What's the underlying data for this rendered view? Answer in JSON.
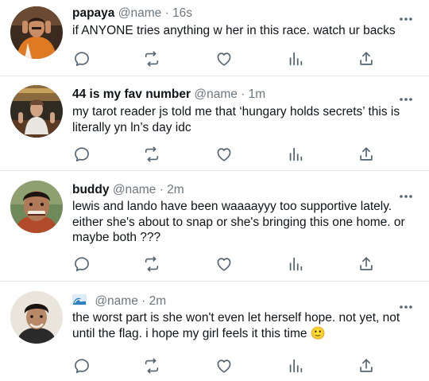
{
  "tweets": [
    {
      "name": "papaya",
      "handle": "@name",
      "time": "16s",
      "text": "if ANYONE tries anything w her in this race. watch ur backs"
    },
    {
      "name": "44 is my fav number",
      "handle": "@name",
      "time": "1m",
      "text": "my tarot reader js told me that ‘hungary holds secrets’ this is literally yn ln’s day idc"
    },
    {
      "name": "buddy",
      "handle": "@name",
      "time": "2m",
      "text": "lewis and lando have been waaaayyy too supportive lately. either she's about to snap or she's bringing this one home. or maybe both ???"
    },
    {
      "name": "",
      "name_icon": "wave-emoji-icon",
      "handle": "@name",
      "time": "2m",
      "text": "the worst part is she won't even let herself hope. not yet, not until the flag. i hope my girl feels it this time 🙂"
    }
  ],
  "separator": "·",
  "icons": [
    "reply-icon",
    "retweet-icon",
    "like-icon",
    "views-icon",
    "share-icon",
    "more-icon"
  ],
  "colors": {
    "text": "#0f1419",
    "secondary": "#6e767d",
    "divider": "#e6e9eb"
  }
}
